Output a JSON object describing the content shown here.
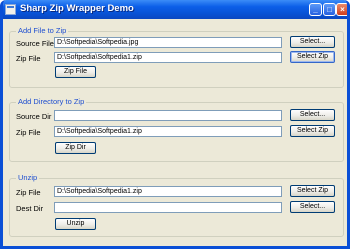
{
  "window": {
    "title": "Sharp Zip Wrapper Demo"
  },
  "add_file": {
    "legend": "Add File to Zip",
    "source_label": "Source File",
    "source_value": "D:\\Softpedia\\Softpedia.jpg",
    "source_select": "Select...",
    "zip_label": "Zip File",
    "zip_value": "D:\\Softpedia\\Softpedia1.zip",
    "zip_select": "Select Zip",
    "action": "Zip File"
  },
  "add_dir": {
    "legend": "Add Directory to Zip",
    "source_label": "Source Dir",
    "source_value": "",
    "source_select": "Select...",
    "zip_label": "Zip File",
    "zip_value": "D:\\Softpedia\\Softpedia1.zip",
    "zip_select": "Select Zip",
    "action": "Zip Dir"
  },
  "unzip": {
    "legend": "Unzip",
    "zip_label": "Zip File",
    "zip_value": "D:\\Softpedia\\Softpedia1.zip",
    "zip_select": "Select Zip",
    "dest_label": "Dest Dir",
    "dest_value": "",
    "dest_select": "Select...",
    "action": "Unzip"
  },
  "icons": {
    "app": "app-icon",
    "minimize": "minimize-icon",
    "maximize": "maximize-icon",
    "close": "close-icon"
  }
}
